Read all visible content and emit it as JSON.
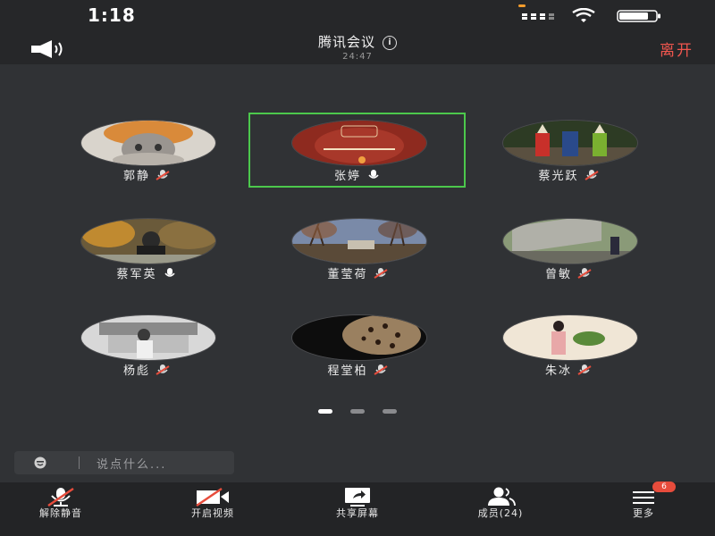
{
  "status_bar": {
    "time": "1:18"
  },
  "header": {
    "title": "腾讯会议",
    "duration": "24:47",
    "leave_label": "离开"
  },
  "participants": [
    {
      "name": "郭静",
      "mic": "muted"
    },
    {
      "name": "张婷",
      "mic": "on",
      "selected": true
    },
    {
      "name": "蔡光跃",
      "mic": "muted"
    },
    {
      "name": "蔡军英",
      "mic": "on"
    },
    {
      "name": "董莹荷",
      "mic": "muted"
    },
    {
      "name": "曾敏",
      "mic": "muted"
    },
    {
      "name": "杨彪",
      "mic": "muted"
    },
    {
      "name": "程堂柏",
      "mic": "muted"
    },
    {
      "name": "朱冰",
      "mic": "muted"
    }
  ],
  "pager": {
    "count": 3,
    "active": 0
  },
  "chat": {
    "placeholder": "说点什么..."
  },
  "toolbar": {
    "unmute_label": "解除静音",
    "video_label": "开启视频",
    "share_label": "共享屏幕",
    "members_label": "成员(24)",
    "more_label": "更多",
    "more_badge": "6"
  },
  "colors": {
    "accent_red": "#f0564e",
    "selection_green": "#4cc84c",
    "badge_red": "#e74c3c"
  }
}
